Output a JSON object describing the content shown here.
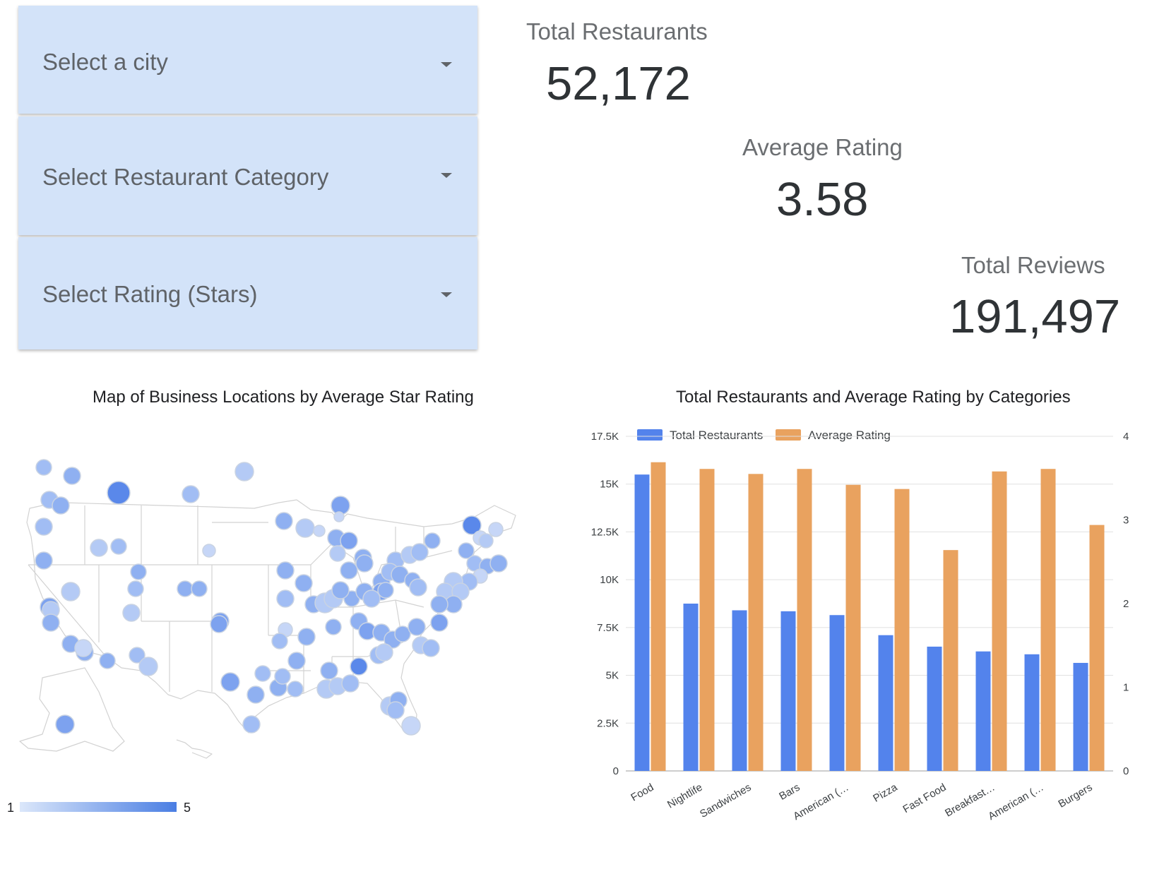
{
  "filters": [
    {
      "label": "Select a city",
      "icon": "chevron-down-icon"
    },
    {
      "label": "Select Restaurant Category",
      "icon": "chevron-down-icon"
    },
    {
      "label": "Select Rating (Stars)",
      "icon": "chevron-down-icon"
    }
  ],
  "kpis": {
    "total_restaurants": {
      "label": "Total Restaurants",
      "value": "52,172"
    },
    "average_rating": {
      "label": "Average Rating",
      "value": "3.58"
    },
    "total_reviews": {
      "label": "Total Reviews",
      "value": "191,497"
    }
  },
  "map": {
    "title": "Map of Business Locations by Average Star Rating",
    "legend_min": "1",
    "legend_max": "5",
    "colors": {
      "low": "#dbe7fa",
      "high": "#4a7ee3",
      "state_border": "#cfcfcf"
    }
  },
  "chart_data": {
    "type": "bar",
    "title": "Total Restaurants and Average Rating by Categories",
    "categories": [
      "Food",
      "Nightlife",
      "Sandwiches",
      "Bars",
      "American (…",
      "Pizza",
      "Fast Food",
      "Breakfast…",
      "American (…",
      "Burgers"
    ],
    "series": [
      {
        "name": "Total Restaurants",
        "axis": "left",
        "color": "#5383ec",
        "values": [
          15500,
          8750,
          8400,
          8350,
          8150,
          7100,
          6500,
          6250,
          6100,
          5650
        ]
      },
      {
        "name": "Average Rating",
        "axis": "right",
        "color": "#e9a25f",
        "values": [
          3.69,
          3.61,
          3.55,
          3.61,
          3.42,
          3.37,
          2.64,
          3.58,
          3.61,
          2.94
        ]
      }
    ],
    "left_axis": {
      "ticks": [
        "0",
        "2.5K",
        "5K",
        "7.5K",
        "10K",
        "12.5K",
        "15K",
        "17.5K"
      ],
      "ylim": [
        0,
        17500
      ]
    },
    "right_axis": {
      "ticks": [
        "0",
        "1",
        "2",
        "3",
        "4"
      ],
      "ylim": [
        0,
        4
      ]
    },
    "grid": true,
    "legend": "top-left"
  }
}
